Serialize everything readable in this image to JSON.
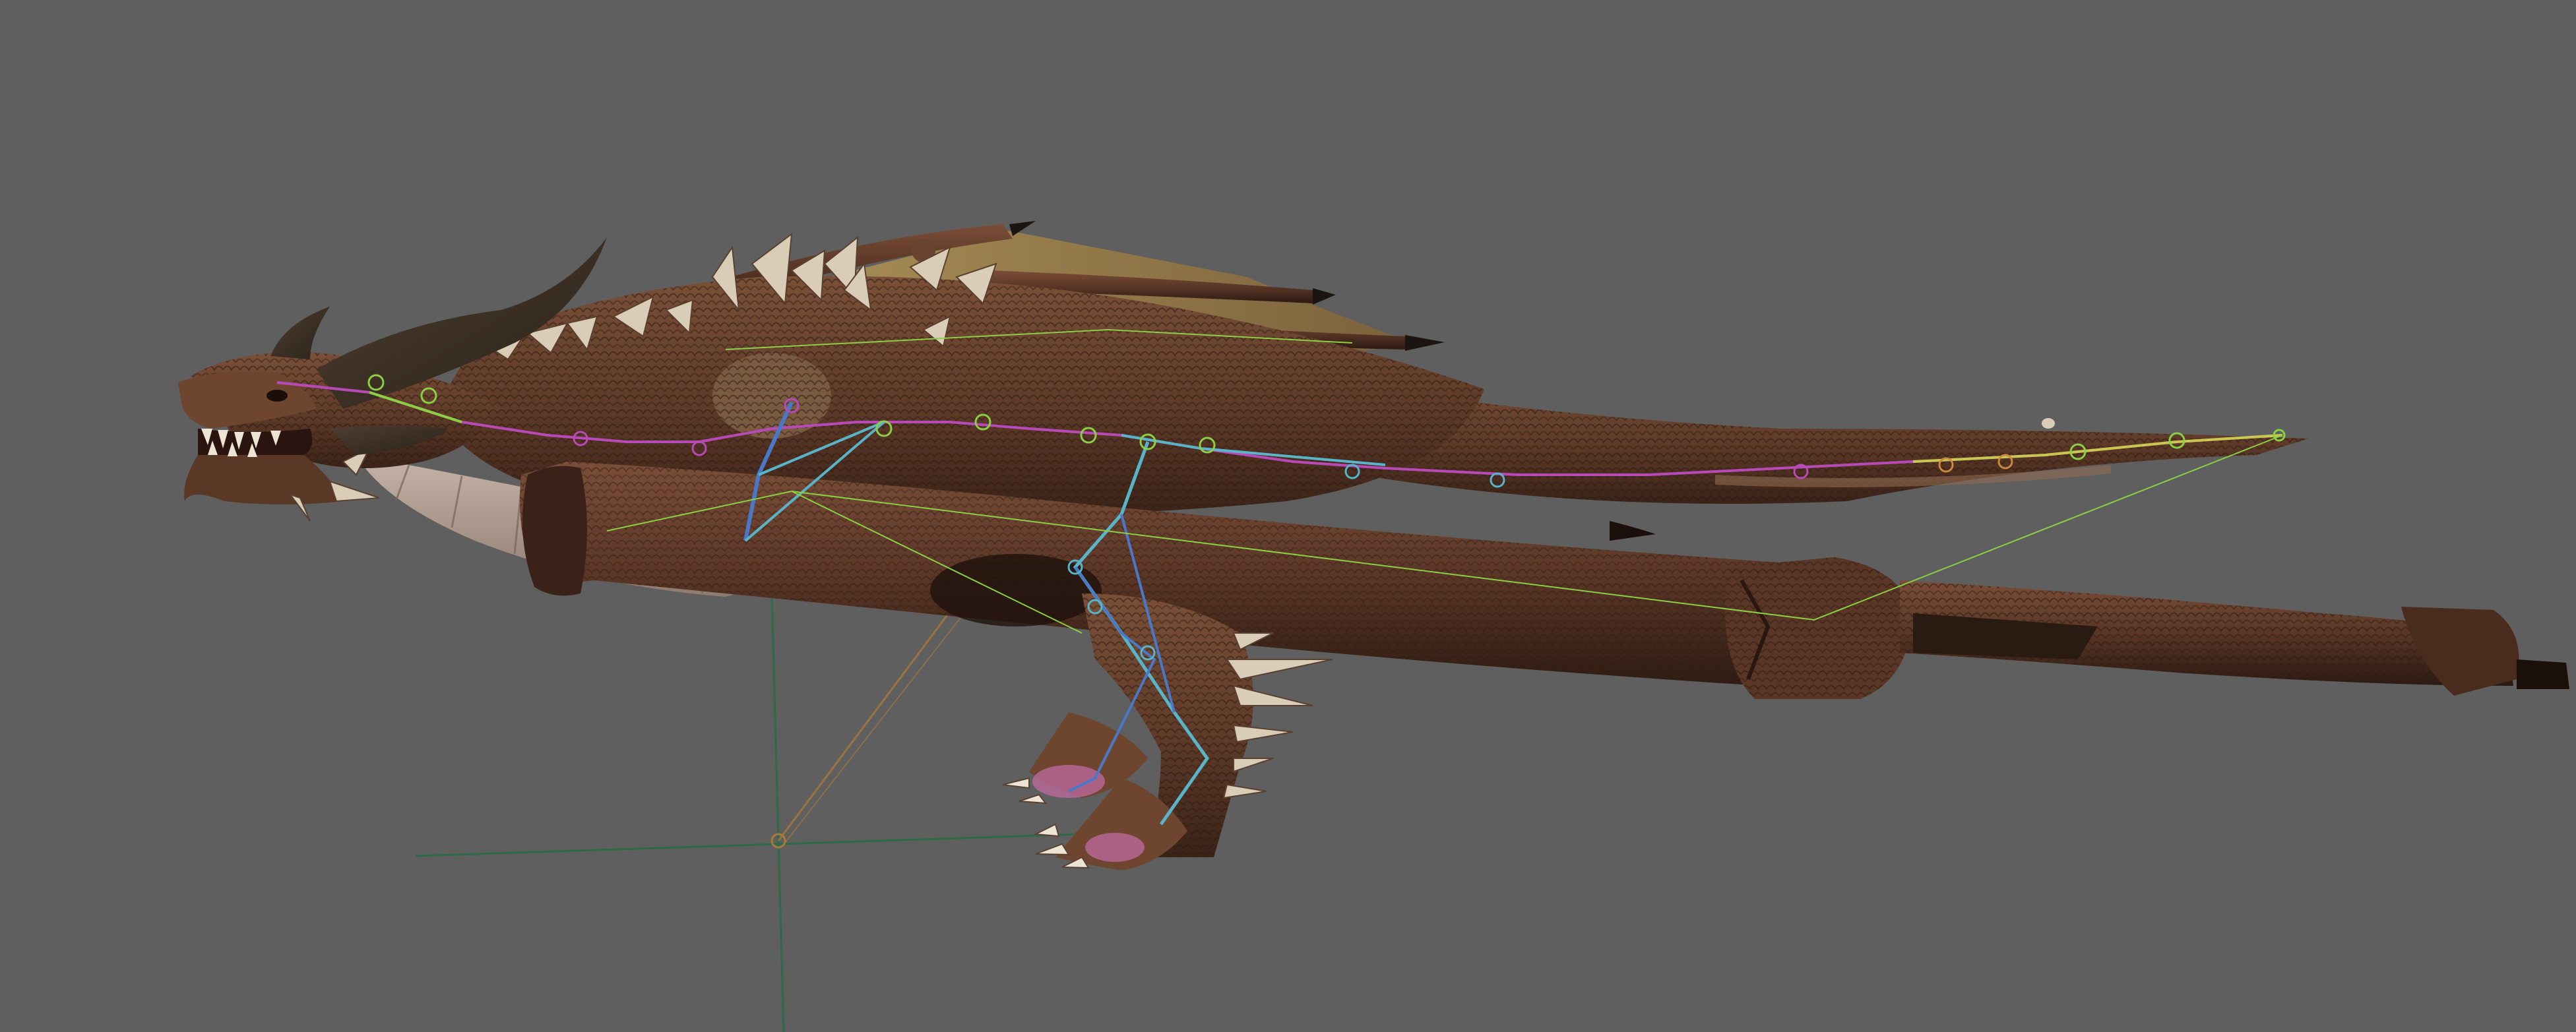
{
  "viewport": {
    "background_color": "#5f5f5f",
    "subject": "dragon-model",
    "colors": {
      "hide_dark": "#3c2418",
      "hide_mid": "#6e4630",
      "hide_light": "#8f6a52",
      "belly": "#b9a79a",
      "wing_membrane": "#a88d52",
      "spike": "#d9cdb8",
      "claw_tint": "#c06aa0",
      "bone_cyan": "#58b4c8",
      "bone_blue": "#4a78c8",
      "bone_green": "#8ad044",
      "bone_yellow": "#c8c850",
      "bone_magenta": "#b84ab8",
      "bone_orange": "#c88a40",
      "helper_green": "#2f6a48",
      "helper_orange": "#a87a3a"
    }
  }
}
